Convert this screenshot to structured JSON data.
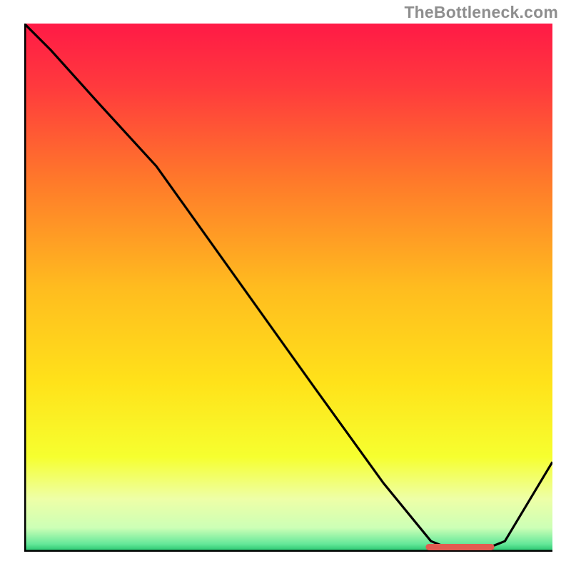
{
  "watermark": "TheBottleneck.com",
  "chart_data": {
    "type": "line",
    "title": "",
    "xlabel": "",
    "ylabel": "",
    "xlim": [
      0,
      100
    ],
    "ylim": [
      0,
      100
    ],
    "grid": false,
    "legend": false,
    "series": [
      {
        "name": "curve",
        "x": [
          0,
          5,
          14,
          25,
          40,
          55,
          68,
          77,
          82,
          86,
          91,
          100
        ],
        "y": [
          100,
          95,
          85,
          73,
          52,
          31,
          13,
          2,
          0,
          0,
          2,
          17
        ]
      }
    ],
    "optimum_marker": {
      "x_start": 76,
      "x_end": 89,
      "y": 0,
      "color": "#e25b50"
    },
    "background_gradient": {
      "stops": [
        {
          "offset": 0.0,
          "color": "#ff1a46"
        },
        {
          "offset": 0.12,
          "color": "#ff3a3d"
        },
        {
          "offset": 0.3,
          "color": "#ff7a2a"
        },
        {
          "offset": 0.5,
          "color": "#ffbc1f"
        },
        {
          "offset": 0.68,
          "color": "#ffe21a"
        },
        {
          "offset": 0.82,
          "color": "#f6ff2f"
        },
        {
          "offset": 0.9,
          "color": "#eeffa7"
        },
        {
          "offset": 0.955,
          "color": "#ccffb6"
        },
        {
          "offset": 0.985,
          "color": "#66e89a"
        },
        {
          "offset": 1.0,
          "color": "#1fc06a"
        }
      ]
    }
  }
}
